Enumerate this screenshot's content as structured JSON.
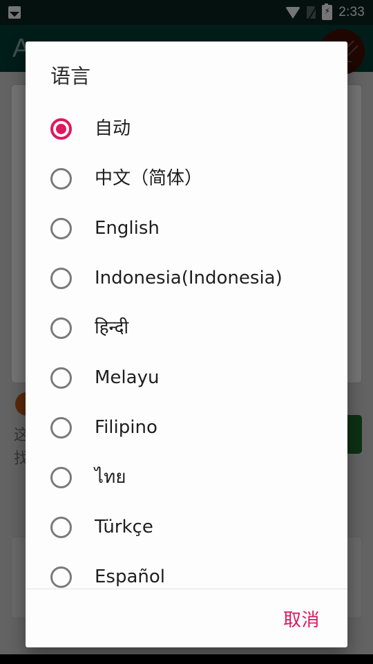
{
  "status_bar": {
    "time": "2:33",
    "notification_icon": "photo-icon",
    "icons": [
      "wifi-icon",
      "no-sim-icon",
      "battery-charging-icon"
    ]
  },
  "background_app": {
    "app_bar_title": "A",
    "fab_icon": "compose-edit-icon",
    "warning_badge": "!",
    "warning_text": "这\n找",
    "green_button_label": ""
  },
  "dialog": {
    "title": "语言",
    "selected_index": 0,
    "options": [
      {
        "label": "自动",
        "selected": true
      },
      {
        "label": "中文（简体）",
        "selected": false
      },
      {
        "label": "English",
        "selected": false
      },
      {
        "label": "Indonesia(Indonesia)",
        "selected": false
      },
      {
        "label": "हिन्दी",
        "selected": false
      },
      {
        "label": "Melayu",
        "selected": false
      },
      {
        "label": "Filipino",
        "selected": false
      },
      {
        "label": "ไทย",
        "selected": false
      },
      {
        "label": "Türkçe",
        "selected": false
      },
      {
        "label": "Español",
        "selected": false
      }
    ],
    "cancel_label": "取消"
  },
  "colors": {
    "accent": "#e0175d",
    "status_bar": "#0b2621",
    "app_bar": "#044039",
    "dialog_bg": "#fdfdfd",
    "radio_unselected": "#7a7a7a",
    "green_button": "#1c6b2c",
    "fab": "#491006",
    "warning": "#c75a14"
  }
}
